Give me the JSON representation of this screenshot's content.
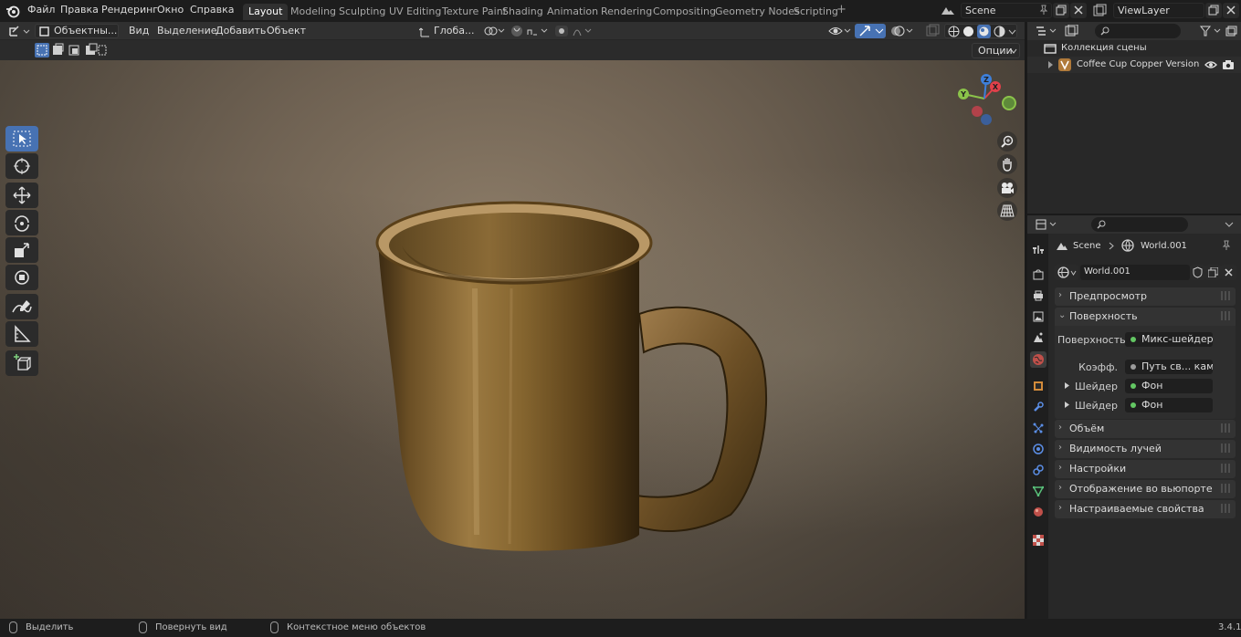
{
  "topbar": {
    "menus": [
      "Файл",
      "Правка",
      "Рендеринг",
      "Окно",
      "Справка"
    ],
    "workspaces": [
      "Layout",
      "Modeling",
      "Sculpting",
      "UV Editing",
      "Texture Paint",
      "Shading",
      "Animation",
      "Rendering",
      "Compositing",
      "Geometry Nodes",
      "Scripting"
    ],
    "active_workspace": "Layout",
    "scene": "Scene",
    "view_layer": "ViewLayer"
  },
  "viewport_header": {
    "mode": "Объектны...",
    "menus": [
      "Вид",
      "Выделение",
      "Добавить",
      "Объект"
    ],
    "orientation": "Глоба...",
    "options": "Опции"
  },
  "gizmo": {
    "x": "X",
    "y": "Y",
    "z": "Z"
  },
  "outliner": {
    "collection": "Коллекция сцены",
    "object": "Coffee Cup Copper Version"
  },
  "properties": {
    "breadcrumb_scene": "Scene",
    "breadcrumb_world": "World.001",
    "world_name": "World.001",
    "panels": {
      "preview": "Предпросмотр",
      "surface": "Поверхность",
      "volume": "Объём",
      "ray_visibility": "Видимость лучей",
      "settings": "Настройки",
      "viewport_display": "Отображение во вьюпорте",
      "custom_props": "Настраиваемые свойства"
    },
    "surface": {
      "surface_label": "Поверхность",
      "surface_value": "Микс-шейдер",
      "fac_label": "Коэфф.",
      "fac_value": "Путь св... камеры",
      "shader1_label": "Шейдер",
      "shader1_value": "Фон",
      "shader2_label": "Шейдер",
      "shader2_value": "Фон"
    }
  },
  "statusbar": {
    "select": "Выделить",
    "rotate": "Повернуть вид",
    "context": "Контекстное меню объектов",
    "version": "3.4.1"
  },
  "colors": {
    "accent": "#4772b3",
    "background": "#1d1d1d",
    "panel": "#303030",
    "mug": "#7a5a2a",
    "socket_green": "#63c763",
    "axis_x": "#e0404a",
    "axis_y": "#8bc34a",
    "axis_z": "#3e7fd9"
  }
}
